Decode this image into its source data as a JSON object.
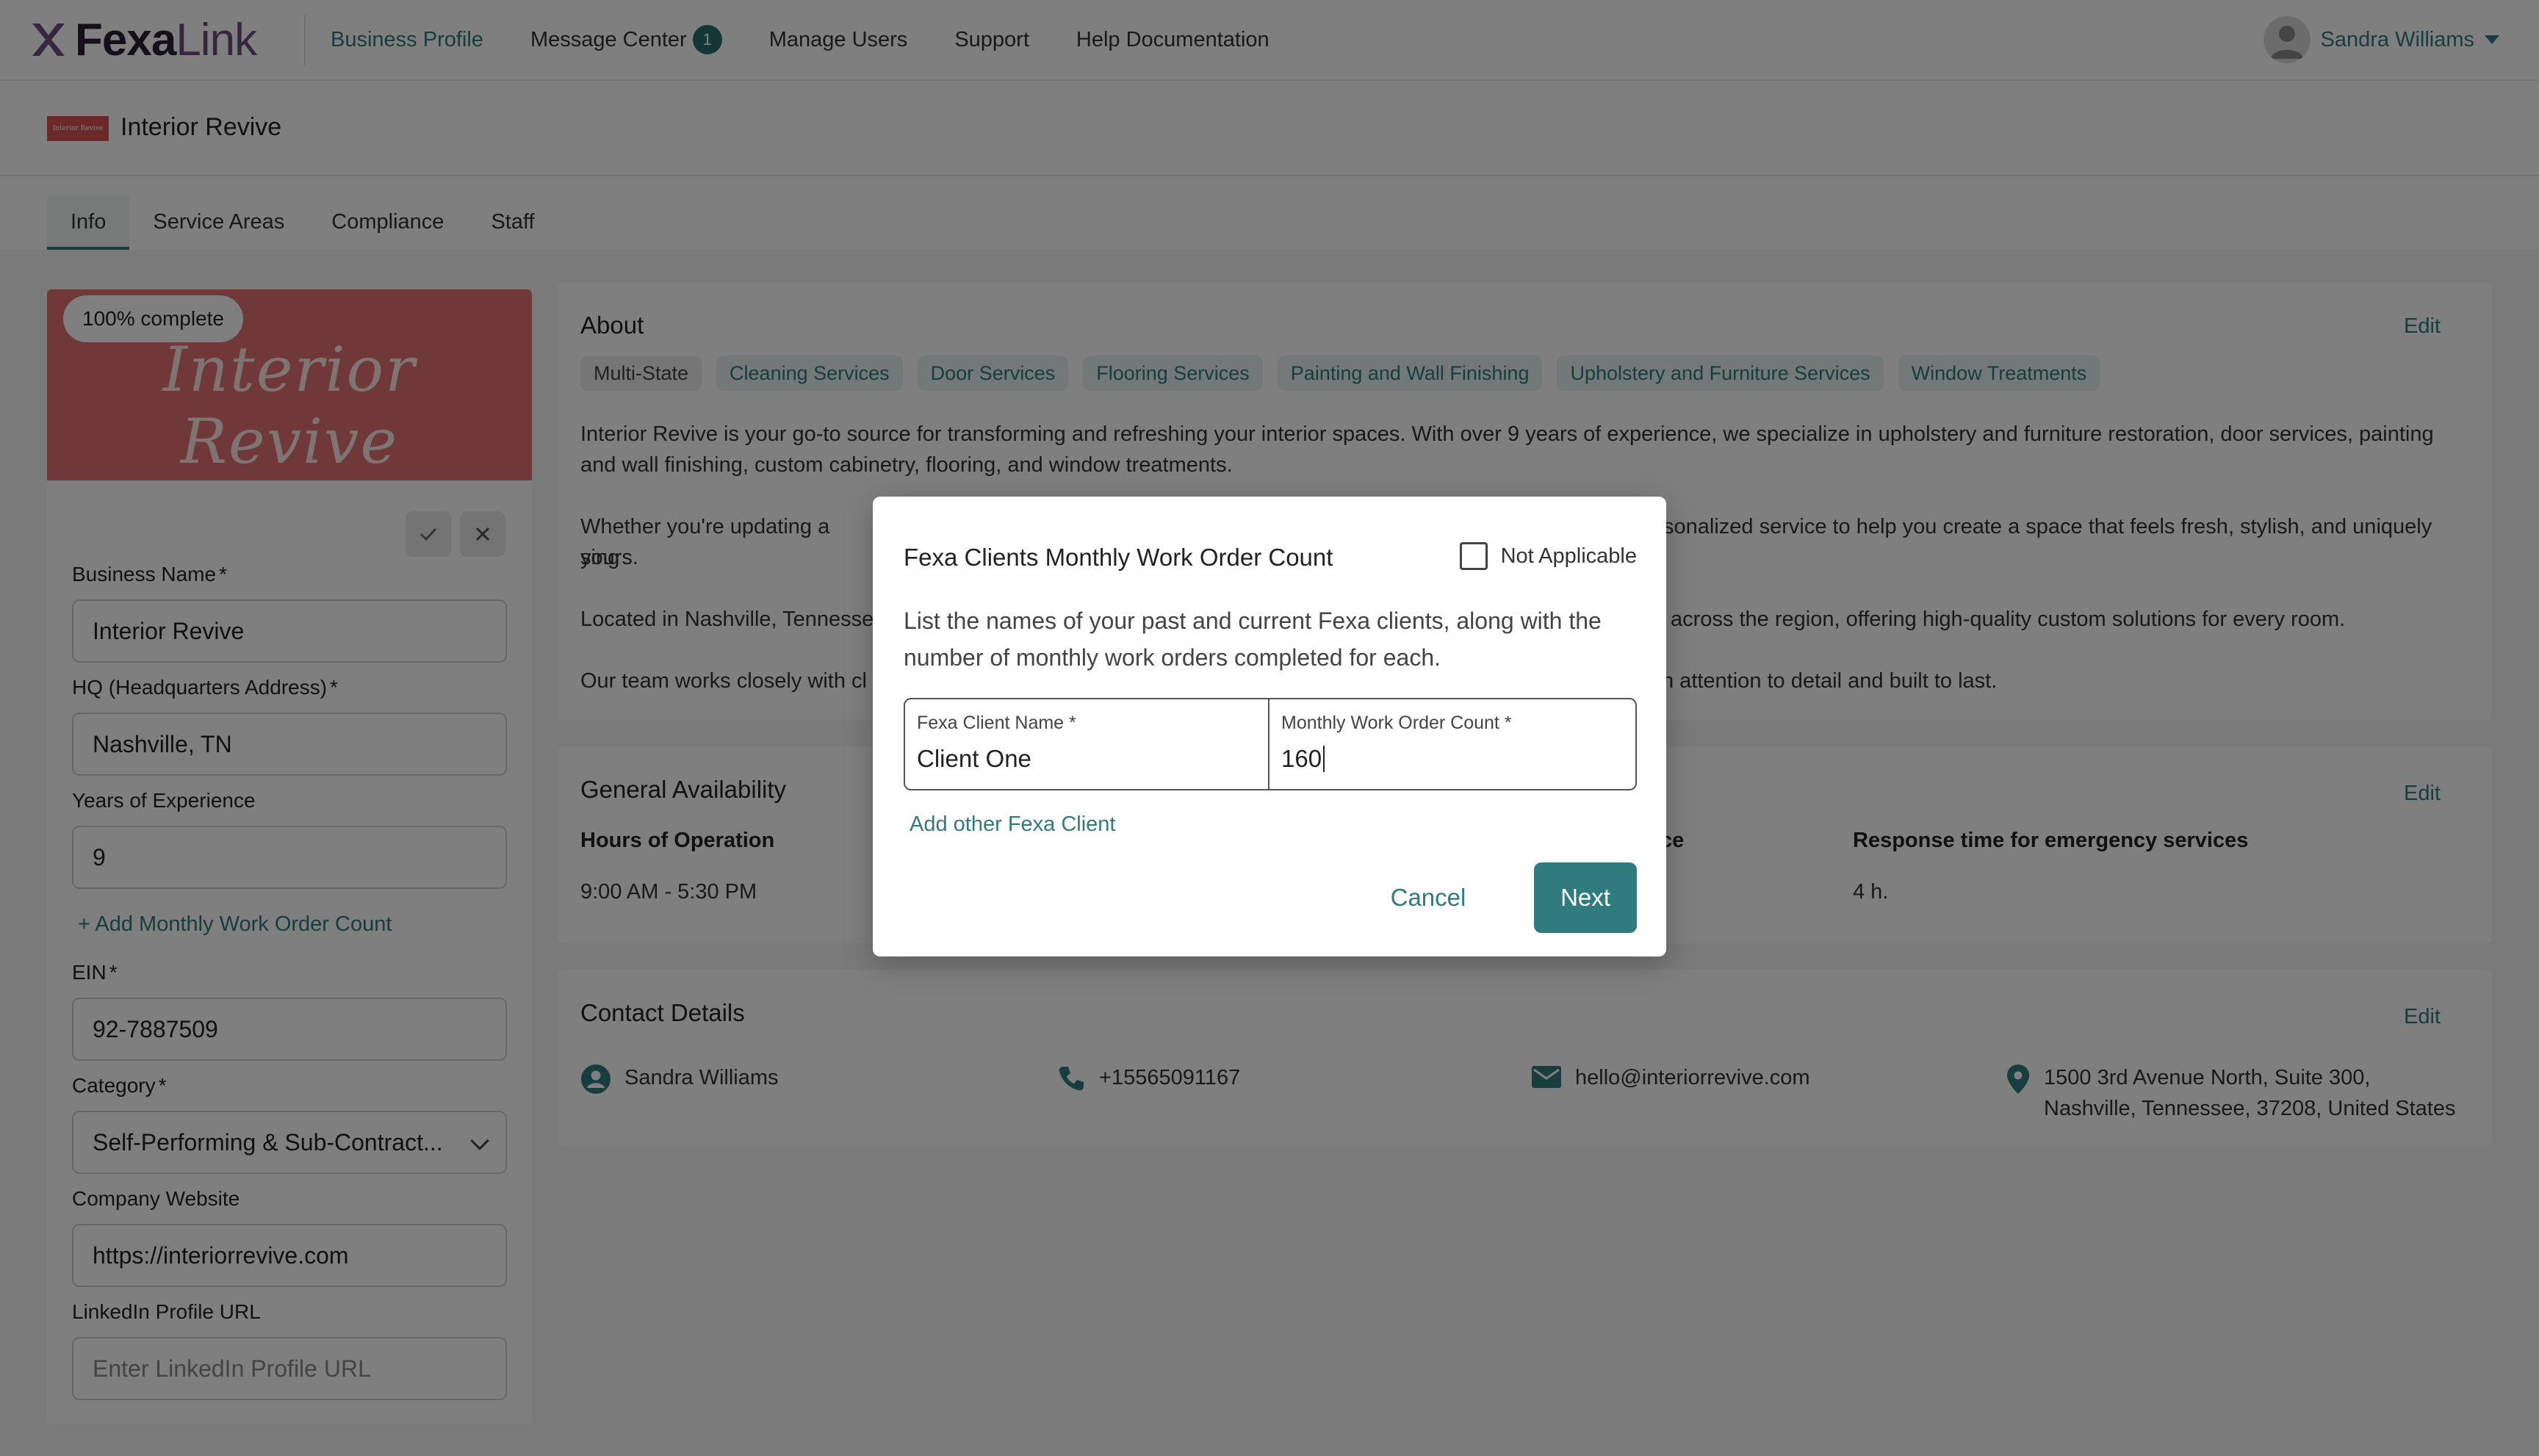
{
  "brand": {
    "logo_part1": "Fexa",
    "logo_part2": "Link"
  },
  "nav": {
    "items": [
      {
        "label": "Business Profile"
      },
      {
        "label": "Message Center",
        "badge": "1"
      },
      {
        "label": "Manage Users"
      },
      {
        "label": "Support"
      },
      {
        "label": "Help Documentation"
      }
    ]
  },
  "user": {
    "name": "Sandra Williams"
  },
  "business": {
    "title": "Interior Revive",
    "cover_text": "Interior Revive"
  },
  "tabs": [
    {
      "label": "Info"
    },
    {
      "label": "Service Areas"
    },
    {
      "label": "Compliance"
    },
    {
      "label": "Staff"
    }
  ],
  "left": {
    "completion": "100% complete",
    "fields": {
      "business_name": {
        "label": "Business Name",
        "value": "Interior Revive"
      },
      "hq": {
        "label": "HQ (Headquarters Address)",
        "value": "Nashville, TN"
      },
      "years": {
        "label": "Years of Experience",
        "value": "9"
      },
      "add_work_order": "+ Add Monthly Work Order Count",
      "ein": {
        "label": "EIN",
        "value": "92-7887509"
      },
      "category": {
        "label": "Category",
        "value": "Self-Performing & Sub-Contract..."
      },
      "website": {
        "label": "Company Website",
        "value": "https://interiorrevive.com"
      },
      "linkedin": {
        "label": "LinkedIn Profile URL",
        "placeholder": "Enter LinkedIn Profile URL"
      }
    },
    "required_mark": "*"
  },
  "about": {
    "title": "About",
    "edit": "Edit",
    "tags": [
      "Multi-State",
      "Cleaning Services",
      "Door Services",
      "Flooring Services",
      "Painting and Wall Finishing",
      "Upholstery and Furniture Services",
      "Window Treatments"
    ],
    "paragraph1": "Interior Revive is your go-to source for transforming and refreshing your interior spaces. With over 9 years of experience, we specialize in upholstery and furniture restoration, door services, painting and wall finishing, custom cabinetry, flooring, and window treatments.",
    "paragraph2_left": "Whether you're updating a sing",
    "paragraph2_right": "sonalized service to help you create a space that feels fresh, stylish, and uniquely",
    "paragraph2_cont": "yours.",
    "paragraph3_left": "Located in Nashville, Tennesse",
    "paragraph3_right": "across the region, offering high-quality custom solutions for every room.",
    "paragraph4_left": "Our team works closely with cl",
    "paragraph4_right": "n attention to detail and built to last."
  },
  "availability": {
    "title": "General Availability",
    "edit": "Edit",
    "hours_label": "Hours of Operation",
    "hours_value": "9:00 AM - 5:30 PM",
    "middle_label_tail": "ce",
    "response_label": "Response time for emergency services",
    "response_value": "4 h."
  },
  "contact": {
    "title": "Contact Details",
    "edit": "Edit",
    "name": "Sandra Williams",
    "phone": "+15565091167",
    "email": "hello@interiorrevive.com",
    "address_line1": "1500 3rd Avenue North, Suite 300,",
    "address_line2": "Nashville, Tennessee, 37208, United States"
  },
  "modal": {
    "title": "Fexa Clients Monthly Work Order Count",
    "not_applicable": "Not Applicable",
    "description": "List the names of your past and current Fexa clients, along with the number of monthly work orders completed for each.",
    "client_name_label": "Fexa Client Name *",
    "client_name_value": "Client One",
    "count_label": "Monthly Work Order Count *",
    "count_value": "160",
    "add_client": "Add other Fexa Client",
    "cancel": "Cancel",
    "next": "Next"
  },
  "colors": {
    "accent": "#2f7b7e",
    "cover": "#e07070",
    "overlay": "rgba(0,0,0,0.5)"
  }
}
